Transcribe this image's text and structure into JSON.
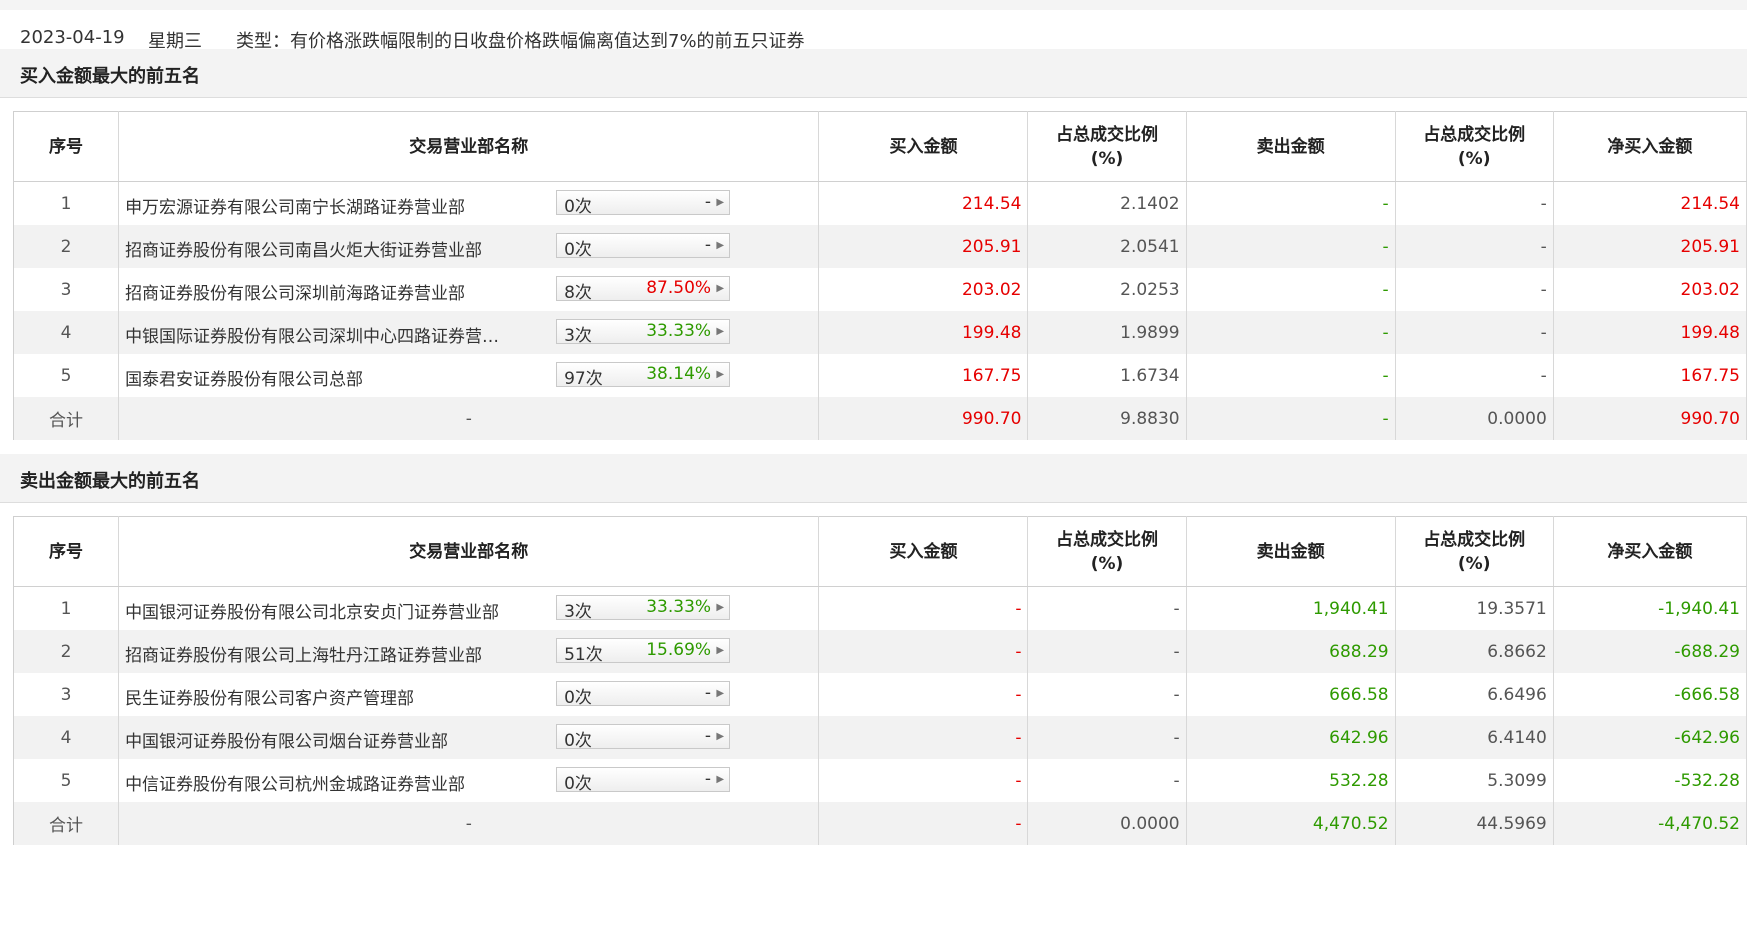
{
  "header": {
    "date": "2023-04-19",
    "weekday": "星期三",
    "type_label": "类型：有价格涨跌幅限制的日收盘价格跌幅偏离值达到7%的前五只证券"
  },
  "columns": {
    "seq": "序号",
    "name": "交易营业部名称",
    "buy": "买入金额",
    "buy_ratio": "占总成交比例(%)",
    "sell": "卖出金额",
    "sell_ratio": "占总成交比例(%)",
    "net": "净买入金额"
  },
  "buy_section": {
    "title": "买入金额最大的前五名",
    "rows": [
      {
        "seq": "1",
        "name": "申万宏源证券有限公司南宁长湖路证券营业部",
        "count": "0次",
        "pct": "-",
        "pct_color": "#333333",
        "buy": "214.54",
        "buy_ratio": "2.1402",
        "sell": "-",
        "sell_ratio": "-",
        "net": "214.54"
      },
      {
        "seq": "2",
        "name": "招商证券股份有限公司南昌火炬大街证券营业部",
        "count": "0次",
        "pct": "-",
        "pct_color": "#333333",
        "buy": "205.91",
        "buy_ratio": "2.0541",
        "sell": "-",
        "sell_ratio": "-",
        "net": "205.91"
      },
      {
        "seq": "3",
        "name": "招商证券股份有限公司深圳前海路证券营业部",
        "count": "8次",
        "pct": "87.50%",
        "pct_color": "#e60000",
        "buy": "203.02",
        "buy_ratio": "2.0253",
        "sell": "-",
        "sell_ratio": "-",
        "net": "203.02"
      },
      {
        "seq": "4",
        "name": "中银国际证券股份有限公司深圳中心四路证券营…",
        "count": "3次",
        "pct": "33.33%",
        "pct_color": "#2e9a00",
        "buy": "199.48",
        "buy_ratio": "1.9899",
        "sell": "-",
        "sell_ratio": "-",
        "net": "199.48"
      },
      {
        "seq": "5",
        "name": "国泰君安证券股份有限公司总部",
        "count": "97次",
        "pct": "38.14%",
        "pct_color": "#2e9a00",
        "buy": "167.75",
        "buy_ratio": "1.6734",
        "sell": "-",
        "sell_ratio": "-",
        "net": "167.75"
      }
    ],
    "total": {
      "label": "合计",
      "name": "-",
      "buy": "990.70",
      "buy_ratio": "9.8830",
      "sell": "-",
      "sell_ratio": "0.0000",
      "net": "990.70"
    }
  },
  "sell_section": {
    "title": "卖出金额最大的前五名",
    "rows": [
      {
        "seq": "1",
        "name": "中国银河证券股份有限公司北京安贞门证券营业部",
        "count": "3次",
        "pct": "33.33%",
        "pct_color": "#2e9a00",
        "buy": "-",
        "buy_ratio": "-",
        "sell": "1,940.41",
        "sell_ratio": "19.3571",
        "net": "-1,940.41"
      },
      {
        "seq": "2",
        "name": "招商证券股份有限公司上海牡丹江路证券营业部",
        "count": "51次",
        "pct": "15.69%",
        "pct_color": "#2e9a00",
        "buy": "-",
        "buy_ratio": "-",
        "sell": "688.29",
        "sell_ratio": "6.8662",
        "net": "-688.29"
      },
      {
        "seq": "3",
        "name": "民生证券股份有限公司客户资产管理部",
        "count": "0次",
        "pct": "-",
        "pct_color": "#333333",
        "buy": "-",
        "buy_ratio": "-",
        "sell": "666.58",
        "sell_ratio": "6.6496",
        "net": "-666.58"
      },
      {
        "seq": "4",
        "name": "中国银河证券股份有限公司烟台证券营业部",
        "count": "0次",
        "pct": "-",
        "pct_color": "#333333",
        "buy": "-",
        "buy_ratio": "-",
        "sell": "642.96",
        "sell_ratio": "6.4140",
        "net": "-642.96"
      },
      {
        "seq": "5",
        "name": "中信证券股份有限公司杭州金城路证券营业部",
        "count": "0次",
        "pct": "-",
        "pct_color": "#333333",
        "buy": "-",
        "buy_ratio": "-",
        "sell": "532.28",
        "sell_ratio": "5.3099",
        "net": "-532.28"
      }
    ],
    "total": {
      "label": "合计",
      "name": "-",
      "buy": "-",
      "buy_ratio": "0.0000",
      "sell": "4,470.52",
      "sell_ratio": "44.5969",
      "net": "-4,470.52"
    }
  },
  "colors": {
    "positive": "#e60000",
    "negative": "#2e9a00",
    "header_bg": "#f3f3f3",
    "stripe": "#f2f2f2"
  }
}
